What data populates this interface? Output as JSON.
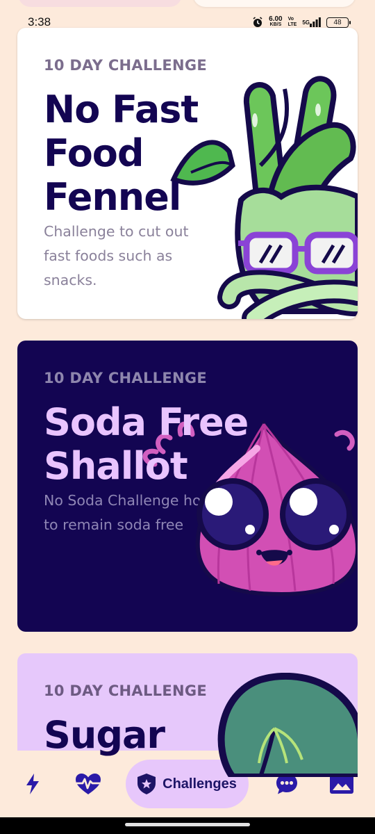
{
  "status_bar": {
    "time": "3:38",
    "net_speed_value": "6.00",
    "net_speed_unit": "KB/S",
    "volte_top": "Vo",
    "volte_bottom": "LTE",
    "signal_label": "5G",
    "battery_level": "48"
  },
  "challenges": [
    {
      "eyebrow": "10 DAY CHALLENGE",
      "title": "No Fast Food Fennel",
      "description": "Challenge to cut out fast foods such as snacks.",
      "illustration": "fennel-mascot"
    },
    {
      "eyebrow": "10 DAY CHALLENGE",
      "title": "Soda Free Shallot",
      "description": "No Soda Challenge how to remain soda free",
      "illustration": "shallot-mascot"
    },
    {
      "eyebrow": "10 DAY CHALLENGE",
      "title": "Sugar",
      "illustration": "leafy-green-mascot"
    }
  ],
  "bottom_nav": {
    "items": [
      {
        "icon": "lightning-icon"
      },
      {
        "icon": "heart-pulse-icon"
      },
      {
        "icon": "shield-star-icon",
        "label": "Challenges",
        "active": true
      },
      {
        "icon": "chat-bubble-icon"
      },
      {
        "icon": "image-icon"
      }
    ]
  },
  "colors": {
    "background": "#fdeadb",
    "card_white": "#ffffff",
    "card_navy": "#130552",
    "card_lilac": "#e6c8fb",
    "accent_active": "#e7c7fb",
    "icon_color": "#2a1aa8"
  }
}
